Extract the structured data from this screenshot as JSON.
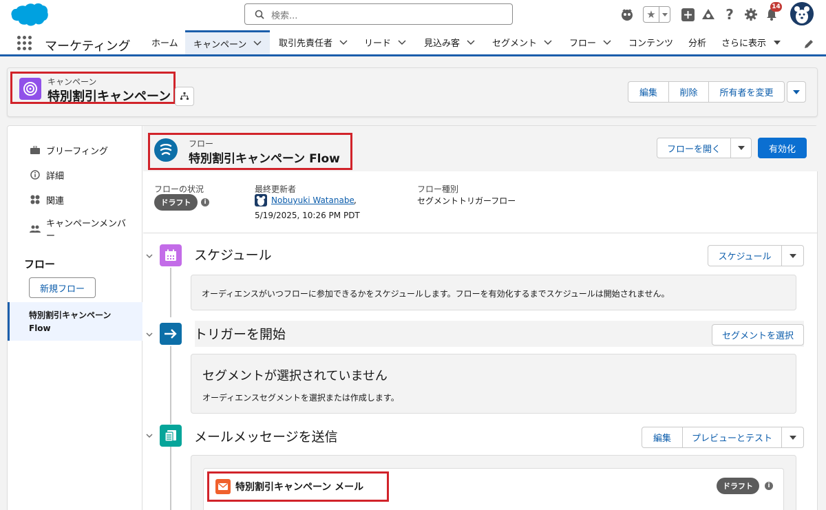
{
  "global_header": {
    "search_placeholder": "検索...",
    "notification_count": "14"
  },
  "nav": {
    "app_name": "マーケティング",
    "tabs": [
      {
        "label": "ホーム"
      },
      {
        "label": "キャンペーン"
      },
      {
        "label": "取引先責任者"
      },
      {
        "label": "リード"
      },
      {
        "label": "見込み客"
      },
      {
        "label": "セグメント"
      },
      {
        "label": "フロー"
      },
      {
        "label": "コンテンツ"
      },
      {
        "label": "分析"
      },
      {
        "label": "さらに表示"
      }
    ]
  },
  "record": {
    "object_label": "キャンペーン",
    "name": "特別割引キャンペーン",
    "buttons": {
      "edit": "編集",
      "delete": "削除",
      "change_owner": "所有者を変更"
    }
  },
  "sidebar": {
    "items": [
      {
        "label": "ブリーフィング",
        "icon": "briefcase-icon"
      },
      {
        "label": "詳細",
        "icon": "info-icon"
      },
      {
        "label": "関連",
        "icon": "related-icon"
      },
      {
        "label": "キャンペーンメンバー",
        "icon": "members-icon"
      }
    ],
    "section_title": "フロー",
    "new_flow_button": "新規フロー",
    "selected_flow": "特別割引キャンペーン Flow"
  },
  "flow": {
    "object_label": "フロー",
    "name": "特別割引キャンペーン Flow",
    "open_button": "フローを開く",
    "activate_button": "有効化",
    "status_label": "フローの状況",
    "status_value": "ドラフト",
    "modified_label": "最終更新者",
    "modified_by": "Nobuyuki Watanabe",
    "modified_date": "5/19/2025, 10:26 PM PDT",
    "type_label": "フロー種別",
    "type_value": "セグメントトリガーフロー"
  },
  "steps": {
    "schedule": {
      "title": "スケジュール",
      "button": "スケジュール",
      "description": "オーディエンスがいつフローに参加できるかをスケジュールします。フローを有効化するまでスケジュールは開始されません。"
    },
    "trigger": {
      "title": "トリガーを開始",
      "button": "セグメントを選択",
      "empty_title": "セグメントが選択されていません",
      "empty_description": "オーディエンスセグメントを選択または作成します。"
    },
    "email": {
      "title": "メールメッセージを送信",
      "edit_button": "編集",
      "preview_button": "プレビューとテスト",
      "email_name": "特別割引キャンペーン メール",
      "email_status": "ドラフト"
    }
  },
  "colors": {
    "brand_blue": "#1b5eab",
    "highlight_red": "#d1232a",
    "campaign_purple": "#9050e9",
    "schedule_purple": "#c36ce8",
    "trigger_blue": "#0d6fa8",
    "email_green": "#06a59a",
    "email_orange": "#f0602c"
  }
}
